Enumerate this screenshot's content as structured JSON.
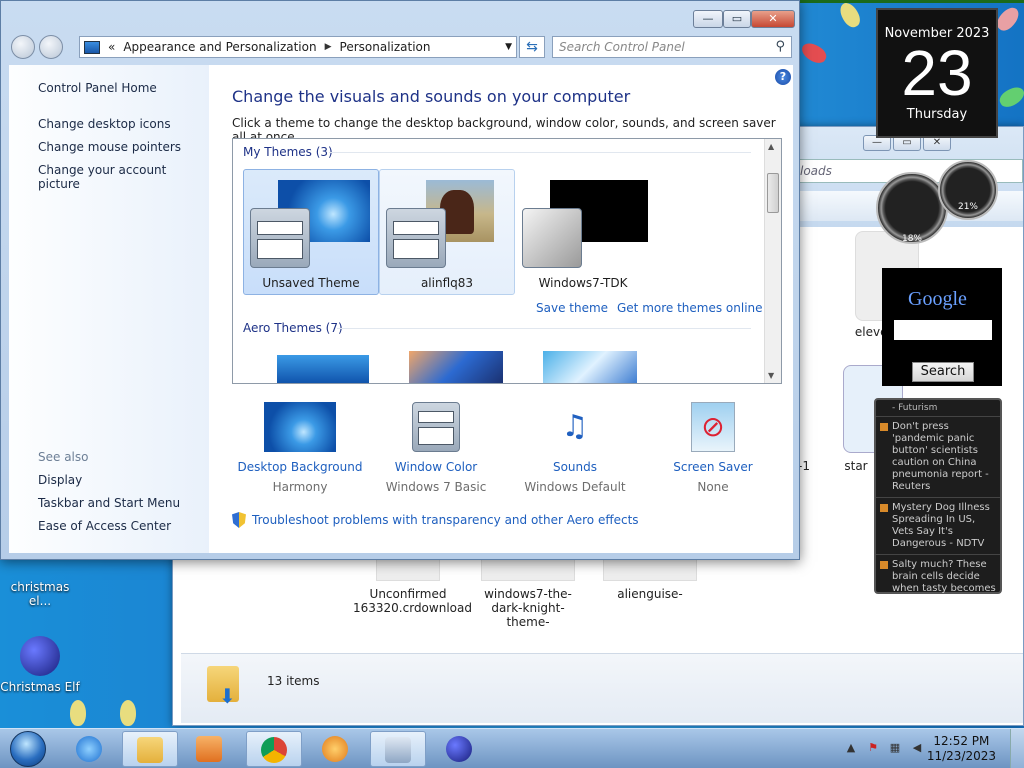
{
  "explorer": {
    "address_text": "loads",
    "items": [
      {
        "label": "Unconfirmed 163320.crdownload"
      },
      {
        "label": "windows7-the-dark-knight-theme-"
      },
      {
        "label": "alienguise-"
      }
    ],
    "partial_label_1": "eleven",
    "partial_label_2": "star",
    "partial_label_3": "-1",
    "status_count": "13 items"
  },
  "gadgets": {
    "calendar": {
      "month_year": "November 2023",
      "day": "23",
      "weekday": "Thursday"
    },
    "cpu_percent": "18%",
    "memory_percent": "21%",
    "google": {
      "logo": "Google",
      "search_label": "Search"
    },
    "news": {
      "header": "- Futurism",
      "items": [
        "Don't press 'pandemic panic button' scientists caution on China pneumonia report - Reuters",
        "Mystery Dog Illness Spreading In US, Vets Say It's Dangerous - NDTV",
        "Salty much? These brain cells decide when tasty becomes"
      ]
    }
  },
  "desktop_icons": [
    {
      "label": "christmas el..."
    },
    {
      "label": "Christmas Elf"
    }
  ],
  "window": {
    "caption_buttons": {
      "minimize": "—",
      "maximize": "▭",
      "close": "✕"
    },
    "breadcrumb": {
      "overflow": "«",
      "part1": "Appearance and Personalization",
      "part2": "Personalization"
    },
    "search_placeholder": "Search Control Panel",
    "help_label": "?",
    "left_nav": {
      "home": "Control Panel Home",
      "links": [
        "Change desktop icons",
        "Change mouse pointers",
        "Change your account picture"
      ],
      "see_also_header": "See also",
      "see_also": [
        "Display",
        "Taskbar and Start Menu",
        "Ease of Access Center"
      ]
    },
    "heading": "Change the visuals and sounds on your computer",
    "subheading": "Click a theme to change the desktop background, window color, sounds, and screen saver all at once.",
    "my_themes_header": "My Themes (3)",
    "my_themes": [
      {
        "name": "Unsaved Theme"
      },
      {
        "name": "alinflq83"
      },
      {
        "name": "Windows7-TDK"
      }
    ],
    "save_theme_link": "Save theme",
    "get_more_link": "Get more themes online",
    "aero_themes_header": "Aero Themes (7)",
    "bottom": [
      {
        "title": "Desktop Background",
        "value": "Harmony"
      },
      {
        "title": "Window Color",
        "value": "Windows 7 Basic"
      },
      {
        "title": "Sounds",
        "value": "Windows Default"
      },
      {
        "title": "Screen Saver",
        "value": "None"
      }
    ],
    "troubleshoot_link": "Troubleshoot problems with transparency and other Aero effects"
  },
  "taskbar": {
    "clock_time": "12:52 PM",
    "clock_date": "11/23/2023"
  }
}
